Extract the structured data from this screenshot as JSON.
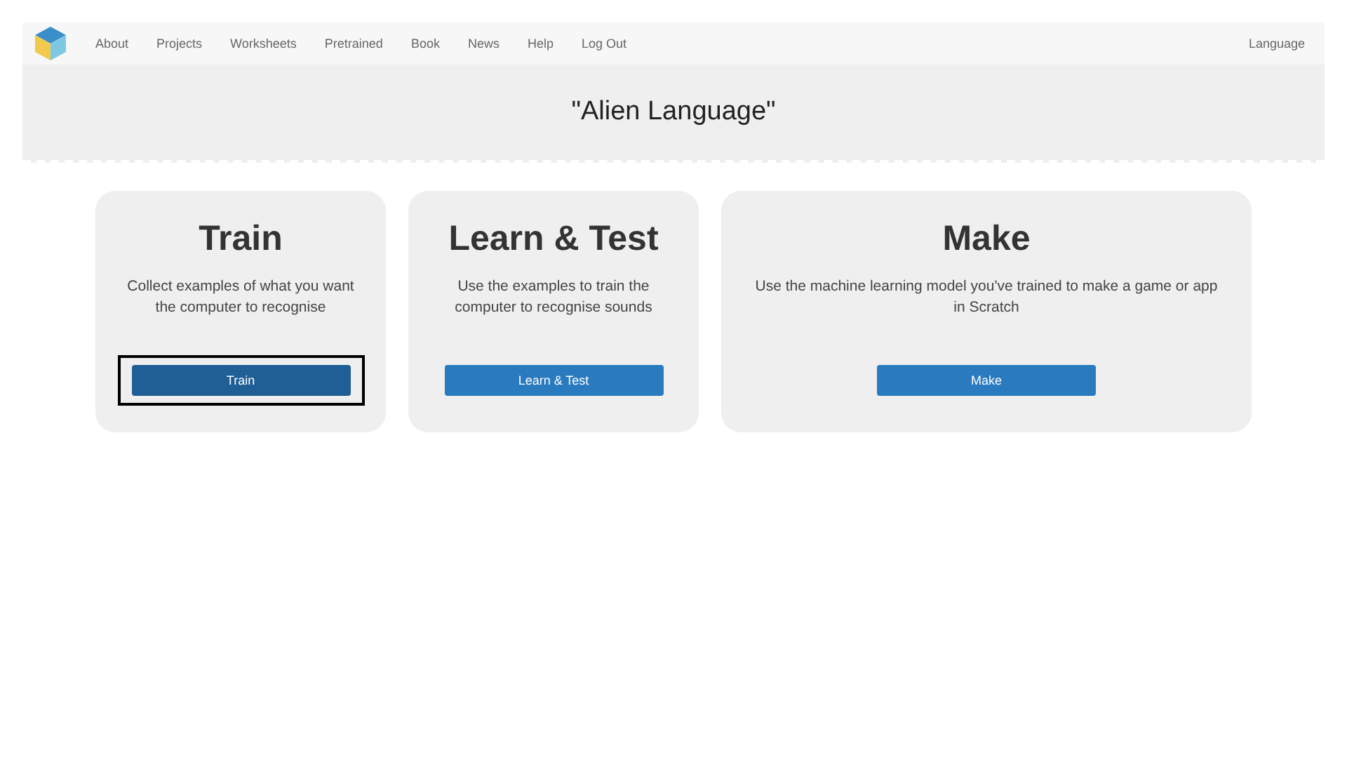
{
  "nav": {
    "items": [
      {
        "label": "About"
      },
      {
        "label": "Projects"
      },
      {
        "label": "Worksheets"
      },
      {
        "label": "Pretrained"
      },
      {
        "label": "Book"
      },
      {
        "label": "News"
      },
      {
        "label": "Help"
      },
      {
        "label": "Log Out"
      }
    ],
    "language": "Language"
  },
  "header": {
    "title": "\"Alien Language\""
  },
  "cards": [
    {
      "title": "Train",
      "description": "Collect examples of what you want the computer to recognise",
      "button": "Train",
      "focused": true,
      "wide": false
    },
    {
      "title": "Learn & Test",
      "description": "Use the examples to train the computer to recognise sounds",
      "button": "Learn & Test",
      "focused": false,
      "wide": false
    },
    {
      "title": "Make",
      "description": "Use the machine learning model you've trained to make a game or app in Scratch",
      "button": "Make",
      "focused": false,
      "wide": true
    }
  ]
}
